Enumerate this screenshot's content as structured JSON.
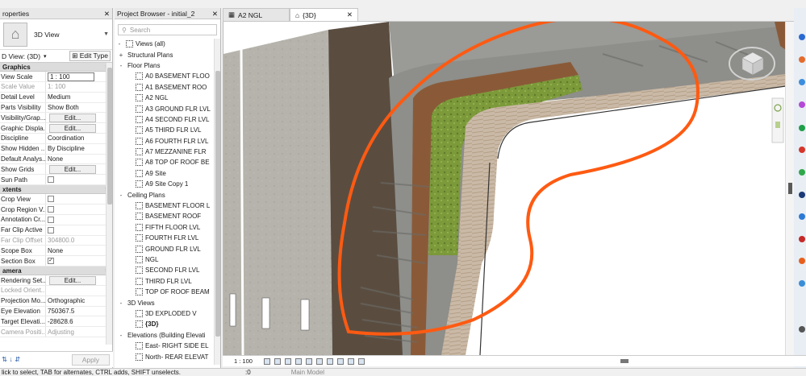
{
  "properties": {
    "title": "roperties",
    "type_name": "3D View",
    "instance_label": "D View: (3D)",
    "edit_type": "Edit Type",
    "apply": "Apply",
    "sections": [
      {
        "name": "Graphics",
        "rows": [
          {
            "k": "View Scale",
            "v": "1 : 100",
            "kind": "input"
          },
          {
            "k": "Scale Value",
            "v": "1:   100",
            "kind": "dis"
          },
          {
            "k": "Detail Level",
            "v": "Medium"
          },
          {
            "k": "Parts Visibility",
            "v": "Show Both"
          },
          {
            "k": "Visibility/Grap...",
            "v": "Edit...",
            "kind": "btn"
          },
          {
            "k": "Graphic Displa...",
            "v": "Edit...",
            "kind": "btn"
          },
          {
            "k": "Discipline",
            "v": "Coordination"
          },
          {
            "k": "Show Hidden ...",
            "v": "By Discipline"
          },
          {
            "k": "Default Analys...",
            "v": "None"
          },
          {
            "k": "Show Grids",
            "v": "Edit...",
            "kind": "btn"
          },
          {
            "k": "Sun Path",
            "v": "",
            "kind": "cb"
          }
        ]
      },
      {
        "name": "xtents",
        "rows": [
          {
            "k": "Crop View",
            "v": "",
            "kind": "cb"
          },
          {
            "k": "Crop Region V...",
            "v": "",
            "kind": "cb"
          },
          {
            "k": "Annotation Cr...",
            "v": "",
            "kind": "cb"
          },
          {
            "k": "Far Clip Active",
            "v": "",
            "kind": "cb"
          },
          {
            "k": "Far Clip Offset",
            "v": "304800.0",
            "kind": "dis"
          },
          {
            "k": "Scope Box",
            "v": "None"
          },
          {
            "k": "Section Box",
            "v": "✓",
            "kind": "cbc"
          }
        ]
      },
      {
        "name": "amera",
        "rows": [
          {
            "k": "Rendering Set...",
            "v": "Edit...",
            "kind": "btn"
          },
          {
            "k": "Locked Orient...",
            "v": "",
            "kind": "dis"
          },
          {
            "k": "Projection Mo...",
            "v": "Orthographic"
          },
          {
            "k": "Eye Elevation",
            "v": "750367.5"
          },
          {
            "k": "Target Elevati...",
            "v": "-28628.6"
          },
          {
            "k": "Camera Positi...",
            "v": "Adjusting",
            "kind": "dis"
          }
        ]
      }
    ]
  },
  "browser": {
    "title": "Project Browser - initial_2",
    "search": "Search",
    "items": [
      {
        "t": "Views (all)",
        "l": 0,
        "e": "-",
        "icon": "views"
      },
      {
        "t": "Structural Plans",
        "l": 1,
        "e": "+"
      },
      {
        "t": "Floor Plans",
        "l": 1,
        "e": "-"
      },
      {
        "t": "A0 BASEMENT FLOO",
        "l": 2,
        "v": 1
      },
      {
        "t": "A1 BASEMENT ROO",
        "l": 2,
        "v": 1
      },
      {
        "t": "A2 NGL",
        "l": 2,
        "v": 1
      },
      {
        "t": "A3 GROUND FLR LVL",
        "l": 2,
        "v": 1
      },
      {
        "t": "A4 SECOND FLR LVL",
        "l": 2,
        "v": 1
      },
      {
        "t": "A5 THIRD FLR LVL",
        "l": 2,
        "v": 1
      },
      {
        "t": "A6 FOURTH FLR LVL",
        "l": 2,
        "v": 1
      },
      {
        "t": "A7 MEZZANINE FLR",
        "l": 2,
        "v": 1
      },
      {
        "t": "A8 TOP OF ROOF BE",
        "l": 2,
        "v": 1
      },
      {
        "t": "A9 Site",
        "l": 2,
        "v": 1
      },
      {
        "t": "A9 Site Copy 1",
        "l": 2,
        "v": 1
      },
      {
        "t": "Ceiling Plans",
        "l": 1,
        "e": "-"
      },
      {
        "t": "BASEMENT FLOOR L",
        "l": 2,
        "v": 1
      },
      {
        "t": "BASEMENT ROOF",
        "l": 2,
        "v": 1
      },
      {
        "t": "FIFTH FLOOR LVL",
        "l": 2,
        "v": 1
      },
      {
        "t": "FOURTH FLR LVL",
        "l": 2,
        "v": 1
      },
      {
        "t": "GROUND FLR LVL",
        "l": 2,
        "v": 1
      },
      {
        "t": "NGL",
        "l": 2,
        "v": 1
      },
      {
        "t": "SECOND FLR LVL",
        "l": 2,
        "v": 1
      },
      {
        "t": "THIRD FLR LVL",
        "l": 2,
        "v": 1
      },
      {
        "t": "TOP OF ROOF BEAM",
        "l": 2,
        "v": 1
      },
      {
        "t": "3D Views",
        "l": 1,
        "e": "-"
      },
      {
        "t": "3D EXPLODED V",
        "l": 2,
        "v": 1
      },
      {
        "t": "{3D}",
        "l": 2,
        "v": 1,
        "bold": true
      },
      {
        "t": "Elevations (Building Elevati",
        "l": 1,
        "e": "-"
      },
      {
        "t": "East- RIGHT SIDE EL",
        "l": 2,
        "v": 1
      },
      {
        "t": "North- REAR ELEVAT",
        "l": 2,
        "v": 1
      }
    ]
  },
  "tabs": [
    {
      "label": "A2 NGL",
      "active": false
    },
    {
      "label": "{3D}",
      "active": true
    }
  ],
  "viewbar": {
    "scale": "1 : 100"
  },
  "status": {
    "text": "lick to select, TAB for alternates, CTRL adds, SHIFT unselects.",
    "model": "Main Model",
    "num": ":0",
    "num2": ":0"
  }
}
